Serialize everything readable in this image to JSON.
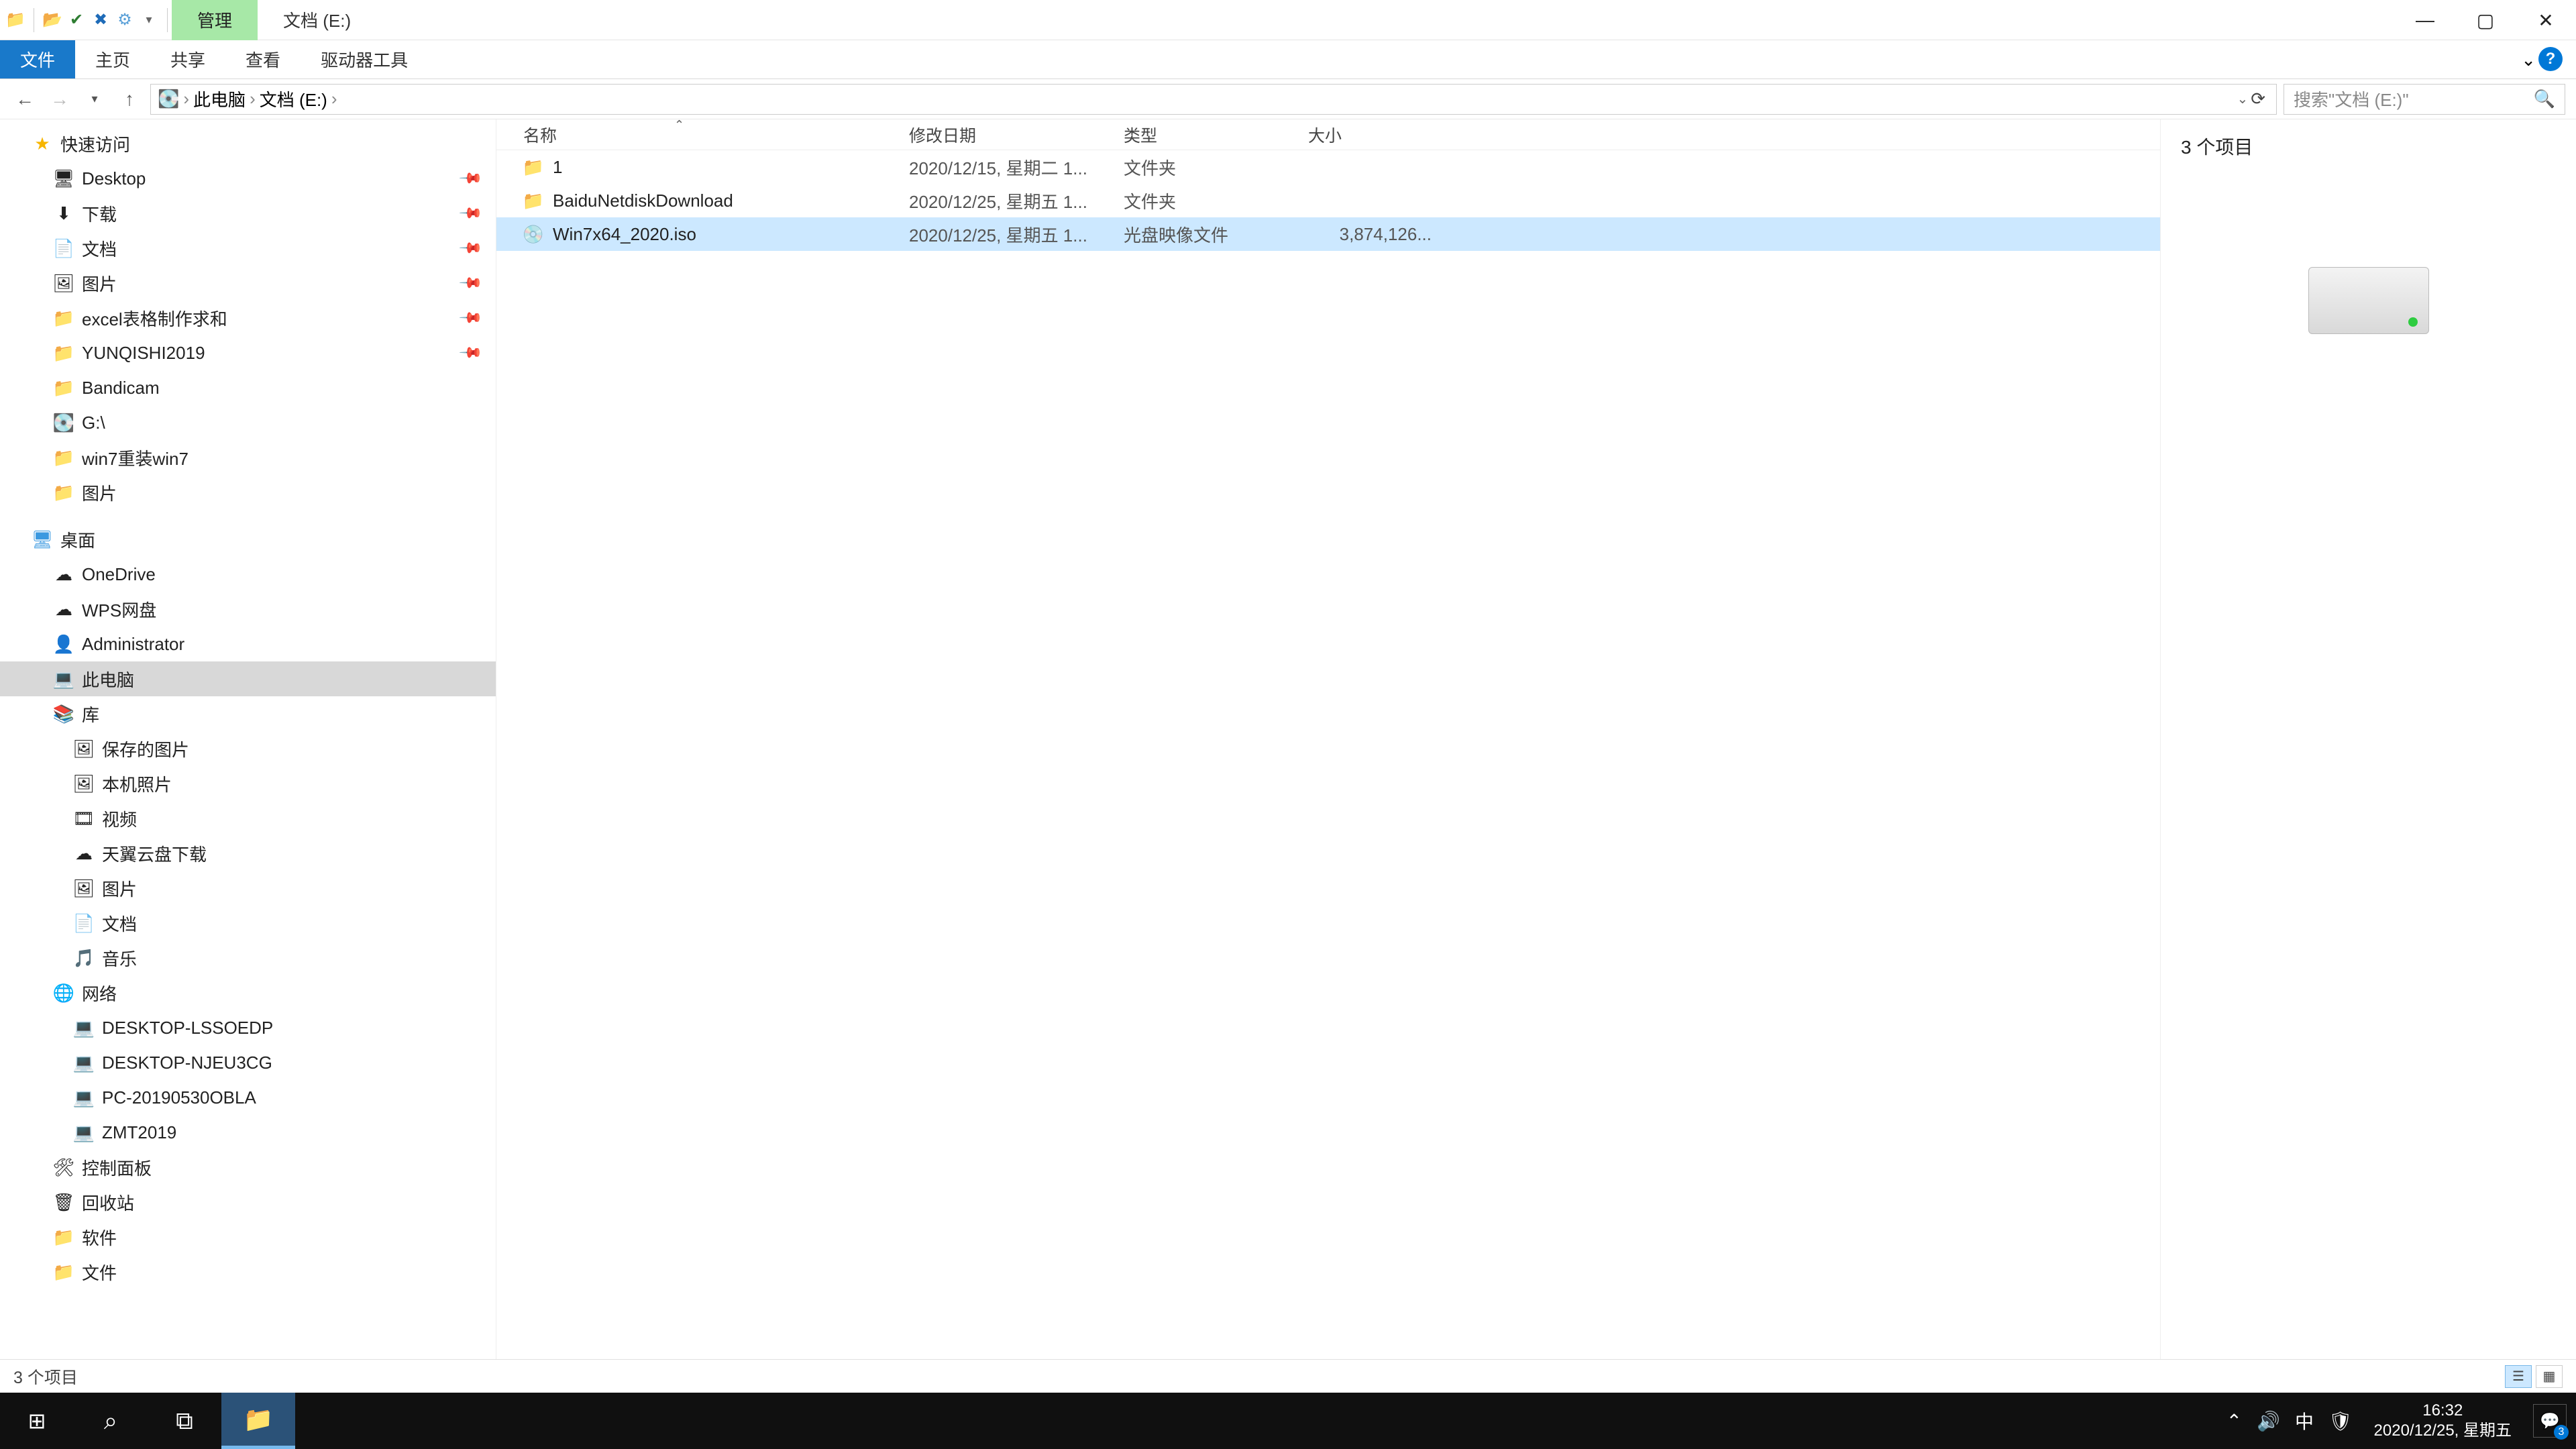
{
  "titlebar": {
    "manage_tab": "管理",
    "context_tab": "文档 (E:)"
  },
  "ribbon": {
    "file": "文件",
    "home": "主页",
    "share": "共享",
    "view": "查看",
    "drive_tools": "驱动器工具"
  },
  "address": {
    "crumbs": [
      "此电脑",
      "文档 (E:)"
    ],
    "search_placeholder": "搜索\"文档 (E:)\""
  },
  "sidebar": {
    "quick_access": "快速访问",
    "quick_items": [
      {
        "label": "Desktop",
        "icon": "🖥",
        "pinned": true
      },
      {
        "label": "下载",
        "icon": "⬇",
        "pinned": true
      },
      {
        "label": "文档",
        "icon": "📄",
        "pinned": true
      },
      {
        "label": "图片",
        "icon": "🖼",
        "pinned": true
      },
      {
        "label": "excel表格制作求和",
        "icon": "📁",
        "pinned": true
      },
      {
        "label": "YUNQISHI2019",
        "icon": "📁",
        "pinned": true
      },
      {
        "label": "Bandicam",
        "icon": "📁",
        "pinned": false
      },
      {
        "label": "G:\\",
        "icon": "💽",
        "pinned": false
      },
      {
        "label": "win7重装win7",
        "icon": "📁",
        "pinned": false
      },
      {
        "label": "图片",
        "icon": "📁",
        "pinned": false
      }
    ],
    "desktop": "桌面",
    "desktop_items": [
      {
        "label": "OneDrive",
        "icon": "☁"
      },
      {
        "label": "WPS网盘",
        "icon": "☁"
      },
      {
        "label": "Administrator",
        "icon": "👤"
      },
      {
        "label": "此电脑",
        "icon": "💻",
        "selected": true
      },
      {
        "label": "库",
        "icon": "📚"
      }
    ],
    "library_items": [
      {
        "label": "保存的图片",
        "icon": "🖼"
      },
      {
        "label": "本机照片",
        "icon": "🖼"
      },
      {
        "label": "视频",
        "icon": "🎞"
      },
      {
        "label": "天翼云盘下载",
        "icon": "☁"
      },
      {
        "label": "图片",
        "icon": "🖼"
      },
      {
        "label": "文档",
        "icon": "📄"
      },
      {
        "label": "音乐",
        "icon": "🎵"
      }
    ],
    "network": "网络",
    "network_items": [
      {
        "label": "DESKTOP-LSSOEDP",
        "icon": "💻"
      },
      {
        "label": "DESKTOP-NJEU3CG",
        "icon": "💻"
      },
      {
        "label": "PC-20190530OBLA",
        "icon": "💻"
      },
      {
        "label": "ZMT2019",
        "icon": "💻"
      }
    ],
    "control_panel": "控制面板",
    "recycle": "回收站",
    "software": "软件",
    "documents": "文件"
  },
  "columns": {
    "name": "名称",
    "date": "修改日期",
    "type": "类型",
    "size": "大小"
  },
  "rows": [
    {
      "name": "1",
      "date": "2020/12/15, 星期二 1...",
      "type": "文件夹",
      "size": "",
      "icon": "📁",
      "icon_class": "ic-folder"
    },
    {
      "name": "BaiduNetdiskDownload",
      "date": "2020/12/25, 星期五 1...",
      "type": "文件夹",
      "size": "",
      "icon": "📁",
      "icon_class": "ic-folder"
    },
    {
      "name": "Win7x64_2020.iso",
      "date": "2020/12/25, 星期五 1...",
      "type": "光盘映像文件",
      "size": "3,874,126...",
      "icon": "💿",
      "icon_class": "ic-disc",
      "selected": true
    }
  ],
  "preview": {
    "count_label": "3 个项目"
  },
  "status": {
    "text": "3 个项目"
  },
  "tray": {
    "time": "16:32",
    "date": "2020/12/25, 星期五",
    "ime": "中",
    "badge": "3"
  }
}
